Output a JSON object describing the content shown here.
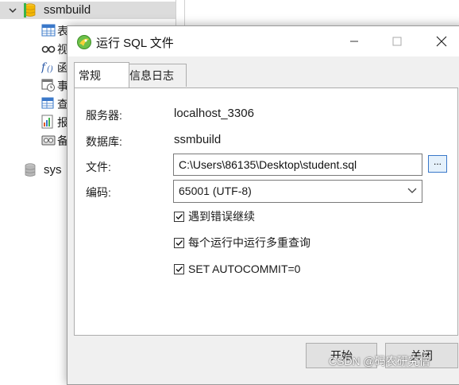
{
  "tree": {
    "db_expanded": "ssmbuild",
    "db_collapsed": "sys",
    "children": [
      {
        "icon": "table-icon",
        "char": "表"
      },
      {
        "icon": "view-icon",
        "char": "视"
      },
      {
        "icon": "function-icon",
        "char": "函"
      },
      {
        "icon": "event-icon",
        "char": "事"
      },
      {
        "icon": "query-icon",
        "char": "查"
      },
      {
        "icon": "report-icon",
        "char": "报"
      },
      {
        "icon": "backup-icon",
        "char": "备"
      }
    ]
  },
  "dialog": {
    "title": "运行 SQL 文件",
    "tabs": [
      "常规",
      "信息日志"
    ],
    "server_label": "服务器:",
    "server_value": "localhost_3306",
    "database_label": "数据库:",
    "database_value": "ssmbuild",
    "file_label": "文件:",
    "file_value": "C:\\Users\\86135\\Desktop\\student.sql",
    "browse_label": "...",
    "encoding_label": "编码:",
    "encoding_value": "65001 (UTF-8)",
    "options": [
      {
        "label": "遇到错误继续",
        "checked": true
      },
      {
        "label": "每个运行中运行多重查询",
        "checked": true
      },
      {
        "label": "SET AUTOCOMMIT=0",
        "checked": true
      }
    ],
    "start_button": "开始",
    "close_button": "关闭"
  },
  "watermark": "CSDN @码农研究僧",
  "colors": {
    "selection": "#dcdcdc",
    "dialog_bg": "#f0f0f0",
    "accent": "#3a78c9",
    "db_yellow": "#f2b705"
  }
}
